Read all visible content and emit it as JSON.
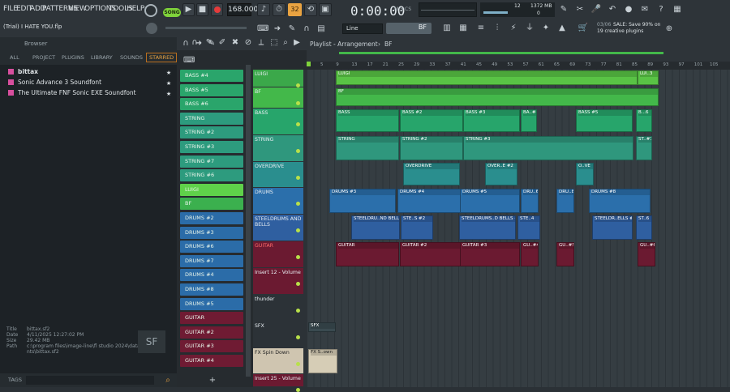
{
  "menu": [
    "FILE",
    "EDIT",
    "ADD",
    "PATTERNS",
    "VIEW",
    "OPTIONS",
    "TOOLS",
    "HELP"
  ],
  "transport": {
    "song_label": "SONG",
    "tempo": "168.000",
    "time": "0:00:00",
    "time_unit": "M:S:CS",
    "cpu": "12",
    "memory": "1372 MB",
    "polyphony": "0",
    "snap": "Line",
    "pattern": "BF"
  },
  "project": {
    "title": "(Trial) I HATE YOU.flp"
  },
  "news": {
    "date": "03/06",
    "line1": "SALE: Save 90% on",
    "line2": "19 creative plugins"
  },
  "browser": {
    "label": "Browser",
    "tabs": [
      "ALL",
      "PROJECT",
      "PLUGINS",
      "LIBRARY",
      "SOUNDS",
      "STARRED"
    ],
    "items": [
      "bittax",
      "Sonic Advance 3 Soundfont",
      "The Ultimate FNF Sonic EXE Soundfont"
    ],
    "info": {
      "title_label": "Title",
      "title": "bittax.sf2",
      "date_label": "Date",
      "date": "4/11/2025 12:27:02 PM",
      "size_label": "Size",
      "size": "29.42 MB",
      "path_label": "Path",
      "path1": "c:\\program files\\image-line\\fl studio 2024\\data\\patches\\soundfo",
      "path2": "nts\\bittax.sf2"
    },
    "tags": "TAGS"
  },
  "channels": [
    "BASS #4",
    "BASS #5",
    "BASS #6",
    "STRING",
    "STRING #2",
    "STRING #3",
    "STRING #7",
    "STRING #6",
    "LUIGI",
    "BF",
    "DRUMS #2",
    "DRUMS #3",
    "DRUMS #6",
    "DRUMS #7",
    "DRUMS #4",
    "DRUMS #8",
    "DRUMS #5",
    "GUITAR",
    "GUITAR #2",
    "GUITAR #3",
    "GUITAR #4"
  ],
  "playlist": {
    "title": "Playlist - Arrangement",
    "pattern": "BF"
  },
  "ruler": [
    "5",
    "9",
    "13",
    "17",
    "21",
    "25",
    "29",
    "33",
    "37",
    "41",
    "45",
    "49",
    "53",
    "57",
    "61",
    "65",
    "69",
    "73",
    "77",
    "81",
    "85",
    "89",
    "93",
    "97",
    "101",
    "105"
  ],
  "tracks": [
    "LUIGI",
    "BF",
    "BASS",
    "STRING",
    "OVERDRIVE",
    "DRUMS",
    "STEELDRUMS AND BELLS",
    "GUITAR",
    "Insert 12 - Volume",
    "thunder",
    "SFX",
    "FX Spin Down",
    "Insert 25 - Volume"
  ],
  "clips": {
    "luigi": "LUIGI",
    "luigi_end": "LUI..3",
    "bf": "BF",
    "bass1": "BASS",
    "bass2": "BASS #2",
    "bass3": "BASS #3",
    "bass4": "BA..#4",
    "bass5": "BASS #5",
    "bass6": "B...6",
    "str1": "STRING",
    "str2": "STRING #2",
    "str3": "STRING #3",
    "str4": "ST..#7",
    "od1": "OVERDRIVE",
    "od2": "OVER..E #2",
    "od3": "O..VE",
    "dr1": "DRUMS #3",
    "dr2": "DRUMS #4",
    "dr3": "DRUMS #5",
    "dr4": "DRU..6",
    "dr5": "DRU..8",
    "dr6": "DRUMS #8",
    "st1": "STEELDRU..ND BELLS",
    "st2": "STE..S #2",
    "st3": "STEELDRUMS..D BELLS #3",
    "st4": "STE..4",
    "st5": "STEELDR..ELLS #3",
    "st6": "ST..6",
    "gt1": "GUITAR",
    "gt2": "GUITAR #2",
    "gt3": "GUITAR #3",
    "gt4": "GU..#4",
    "gt5": "GU..#5",
    "gt6": "GU..#6",
    "sfx": "SFX",
    "fx": "FX S..own"
  }
}
